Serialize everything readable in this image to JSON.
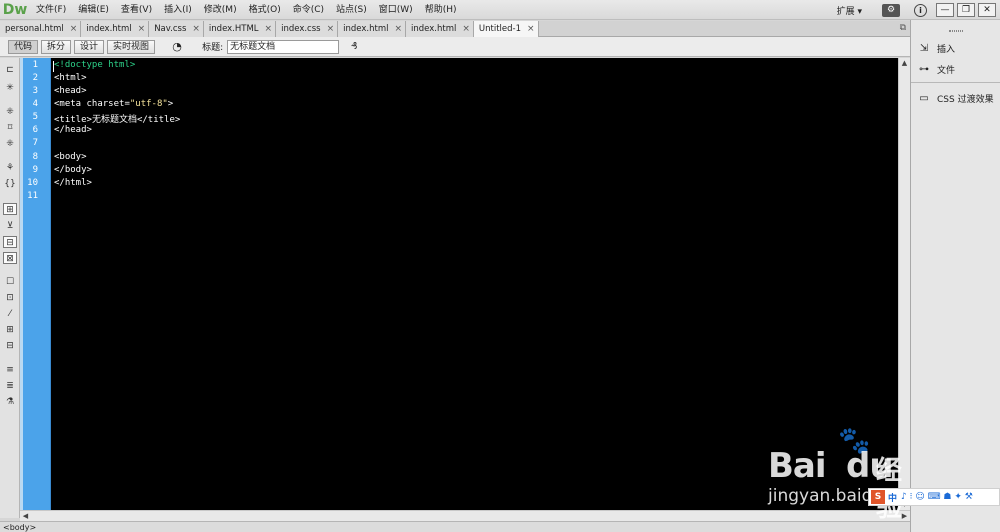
{
  "app": {
    "logo": "Dw"
  },
  "menu": {
    "items": [
      "文件(F)",
      "编辑(E)",
      "查看(V)",
      "插入(I)",
      "修改(M)",
      "格式(O)",
      "命令(C)",
      "站点(S)",
      "窗口(W)",
      "帮助(H)"
    ],
    "extension": "扩展",
    "gear_label": "⚙",
    "info_label": "i",
    "minimize": "—",
    "restore": "❐",
    "close": "✕"
  },
  "tabs": {
    "items": [
      "personal.html",
      "index.html",
      "Nav.css",
      "index.HTML",
      "index.css",
      "index.html",
      "index.html",
      "Untitled-1"
    ],
    "close_glyph": "×",
    "restore_glyph": "⧉"
  },
  "toolbar": {
    "code": "代码",
    "split": "拆分",
    "design": "设计",
    "live_view": "实时视图",
    "title_label": "标题:",
    "title_value": "无标题文档",
    "globe_glyph": "◔",
    "check_glyph": "₰"
  },
  "left_tools": [
    "⊏",
    "✳",
    "⁜",
    "⌑",
    "⁜",
    "⚘",
    "{}",
    "⊞",
    "⊻",
    "⊟",
    "⊠",
    "☐",
    "⊡",
    "⁄",
    "⊞",
    "⊟",
    "≡",
    "≣",
    "⚗"
  ],
  "editor": {
    "line_numbers": [
      "1",
      "2",
      "3",
      "4",
      "5",
      "6",
      "7",
      "8",
      "9",
      "10",
      "11"
    ],
    "lines": [
      {
        "tag": "",
        "doc": "<!doctype html>",
        "str": "",
        "text": ""
      },
      {
        "tag": "<html>",
        "doc": "",
        "str": "",
        "text": ""
      },
      {
        "tag": "<head>",
        "doc": "",
        "str": "",
        "text": ""
      },
      {
        "tag": "<meta charset=",
        "doc": "",
        "str": "\"utf-8\"",
        "text": ">"
      },
      {
        "tag": "<title>",
        "doc": "",
        "str": "",
        "text": "无标题文档</title>"
      },
      {
        "tag": "</head>",
        "doc": "",
        "str": "",
        "text": ""
      },
      {
        "tag": "",
        "doc": "",
        "str": "",
        "text": ""
      },
      {
        "tag": "<body>",
        "doc": "",
        "str": "",
        "text": ""
      },
      {
        "tag": "</body>",
        "doc": "",
        "str": "",
        "text": ""
      },
      {
        "tag": "</html>",
        "doc": "",
        "str": "",
        "text": ""
      },
      {
        "tag": "",
        "doc": "",
        "str": "",
        "text": ""
      }
    ]
  },
  "statusbar": {
    "tag": "<body>"
  },
  "right_panel": {
    "insert": "插入",
    "files": "文件",
    "css_transitions": "CSS 过渡效果"
  },
  "watermark": {
    "big": "Bai",
    "paw": "🐾",
    "du": "du",
    "cn": "经验",
    "small": "jingyan.baidu.com"
  },
  "ime": {
    "logo": "S",
    "lang": "中",
    "icons": "♪ ⁝ ☺ ⌨ ☗ ✦ ⚒"
  }
}
